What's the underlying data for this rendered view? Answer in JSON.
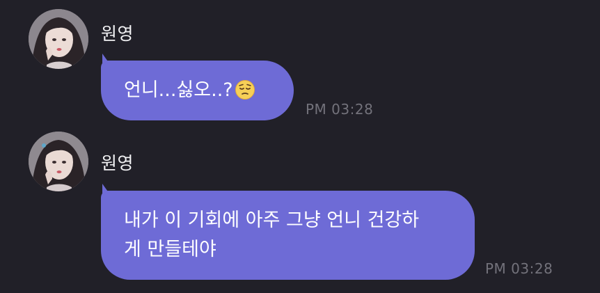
{
  "colors": {
    "background": "#212028",
    "bubble": "#6e6bd6",
    "timestamp": "#73727b",
    "name": "#f2f2f4"
  },
  "messages": [
    {
      "sender": "원영",
      "avatar_icon": "profile-photo",
      "text": "언니...싫오..?",
      "emoji_icon": "pensive-face-emoji",
      "time": "PM 03:28"
    },
    {
      "sender": "원영",
      "avatar_icon": "profile-photo",
      "text_line_1": "내가 이 기회에 아주 그냥 언니 건강하",
      "text_line_2": "게 만들테야",
      "time": "PM 03:28"
    }
  ]
}
